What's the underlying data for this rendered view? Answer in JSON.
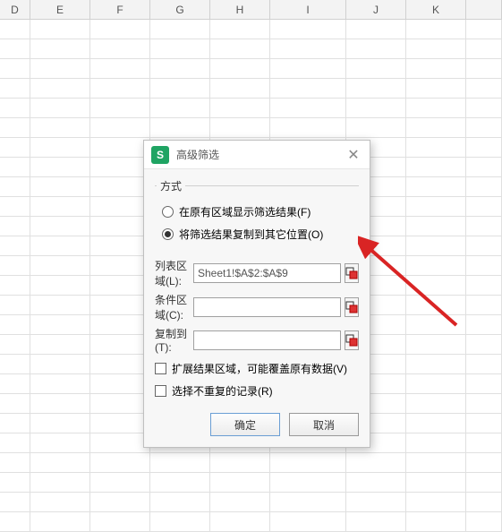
{
  "columns": [
    "D",
    "E",
    "F",
    "G",
    "H",
    "I",
    "J",
    "K",
    ""
  ],
  "dialog": {
    "app_icon_letter": "S",
    "title": "高级筛选",
    "mode": {
      "legend": "方式",
      "option_inplace": "在原有区域显示筛选结果(F)",
      "option_copy": "将筛选结果复制到其它位置(O)",
      "selected": "copy"
    },
    "fields": {
      "list_label": "列表区域(L):",
      "list_value": "Sheet1!$A$2:$A$9",
      "criteria_label": "条件区域(C):",
      "criteria_value": "",
      "copyto_label": "复制到(T):",
      "copyto_value": ""
    },
    "checks": {
      "expand_label": "扩展结果区域，可能覆盖原有数据(V)",
      "unique_label": "选择不重复的记录(R)"
    },
    "buttons": {
      "ok": "确定",
      "cancel": "取消"
    }
  }
}
